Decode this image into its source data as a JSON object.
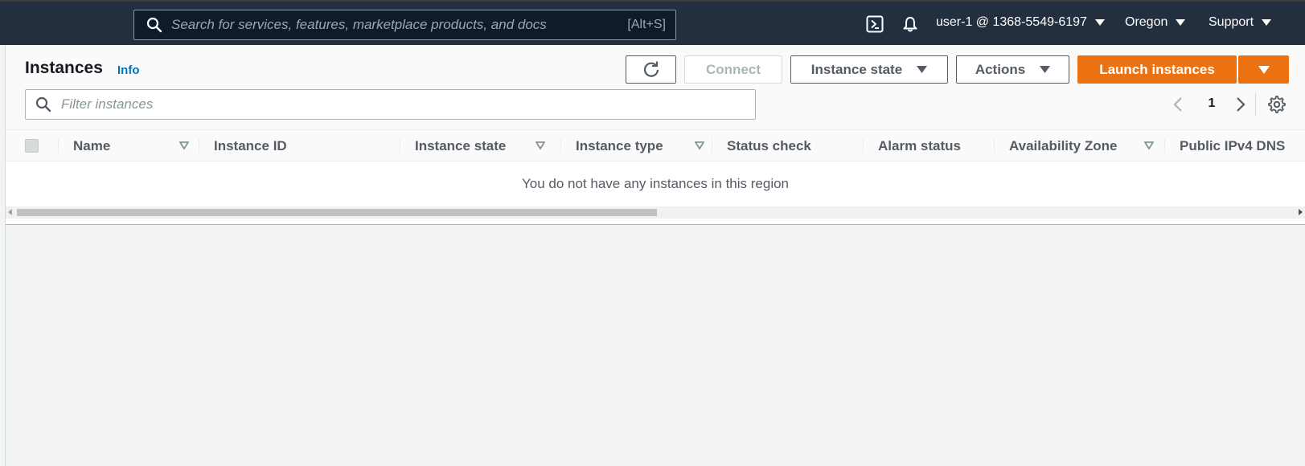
{
  "topnav": {
    "search": {
      "placeholder": "Search for services, features, marketplace products, and docs",
      "shortcut": "[Alt+S]",
      "icon": "search-icon"
    },
    "cloudshell_icon": "cloudshell-icon",
    "notifications_icon": "bell-icon",
    "account_label": "user-1 @ 1368-5549-6197",
    "region_label": "Oregon",
    "support_label": "Support",
    "background_color": "#232f3e"
  },
  "panel": {
    "title": "Instances",
    "info_label": "Info",
    "buttons": {
      "refresh_icon": "refresh-icon",
      "connect_label": "Connect",
      "instance_state_label": "Instance state",
      "actions_label": "Actions",
      "launch_label": "Launch instances",
      "launch_color": "#ec7211"
    },
    "filter": {
      "placeholder": "Filter instances",
      "icon": "search-icon"
    },
    "pagination": {
      "current_page": "1",
      "prev_icon": "chevron-left-icon",
      "next_icon": "chevron-right-icon"
    },
    "settings_icon": "gear-icon"
  },
  "table": {
    "columns": [
      {
        "label": "Name",
        "sortable": true
      },
      {
        "label": "Instance ID",
        "sortable": false
      },
      {
        "label": "Instance state",
        "sortable": true
      },
      {
        "label": "Instance type",
        "sortable": true
      },
      {
        "label": "Status check",
        "sortable": false
      },
      {
        "label": "Alarm status",
        "sortable": false
      },
      {
        "label": "Availability Zone",
        "sortable": true
      },
      {
        "label": "Public IPv4 DNS",
        "sortable": false
      }
    ],
    "empty_message": "You do not have any instances in this region",
    "rows": []
  }
}
